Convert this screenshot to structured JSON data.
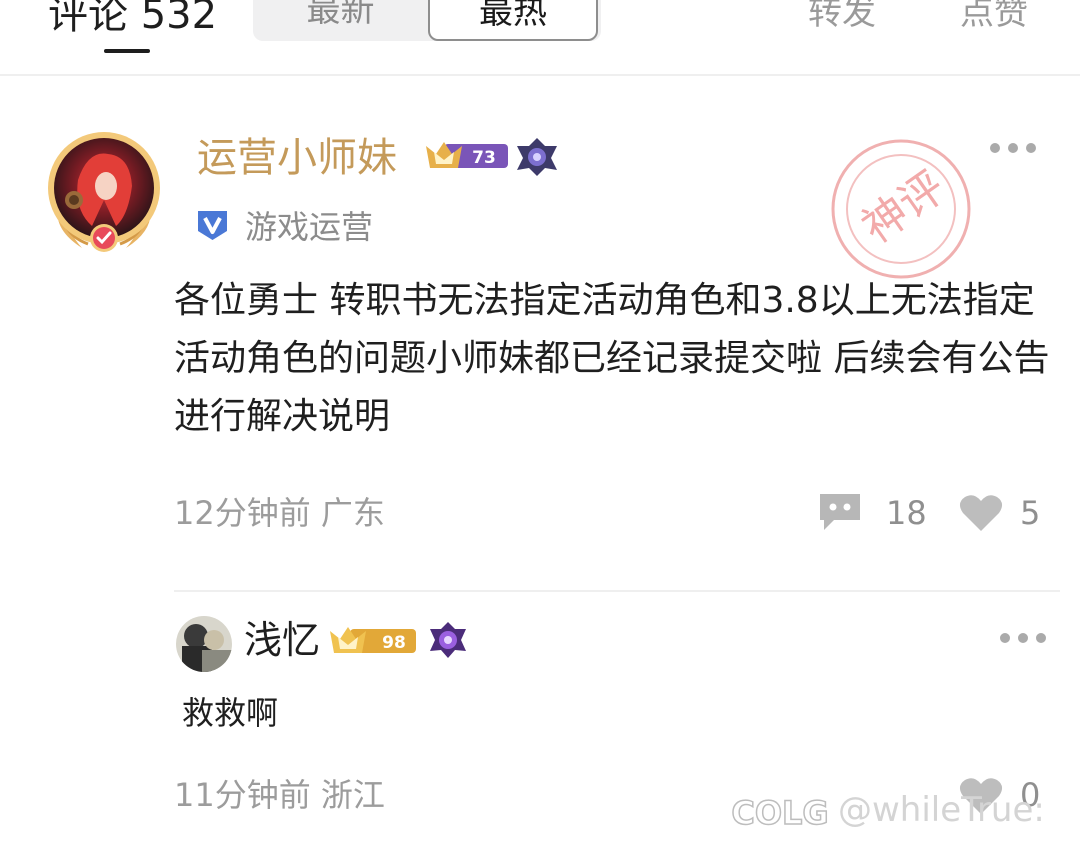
{
  "header": {
    "comment_count_label": "评论 532",
    "tabs": [
      {
        "label": "最新",
        "active": false
      },
      {
        "label": "最热",
        "active": true
      }
    ],
    "forward_label": "转发",
    "like_label": "点赞"
  },
  "comments": [
    {
      "username": "运营小师妹",
      "level": "73",
      "verified_title": "游戏运营",
      "stamp_text": "神评",
      "content": "各位勇士 转职书无法指定活动角色和3.8以上无法指定活动角色的问题小师妹都已经记录提交啦 后续会有公告进行解决说明",
      "time": "12分钟前",
      "location": "广东",
      "reply_count": "18",
      "like_count": "5"
    },
    {
      "username": "浅忆",
      "level": "98",
      "content": "救救啊",
      "time": "11分钟前",
      "location": "浙江",
      "like_count": "0"
    }
  ],
  "watermark": {
    "logo": "COLG",
    "text": "@whileTrue:"
  },
  "colors": {
    "username_gold": "#c49a5a",
    "muted_text": "#9c9c9c",
    "badge_purple": "#7a55b8",
    "stamp_red": "#e89090",
    "verified_blue": "#4a78d6"
  }
}
